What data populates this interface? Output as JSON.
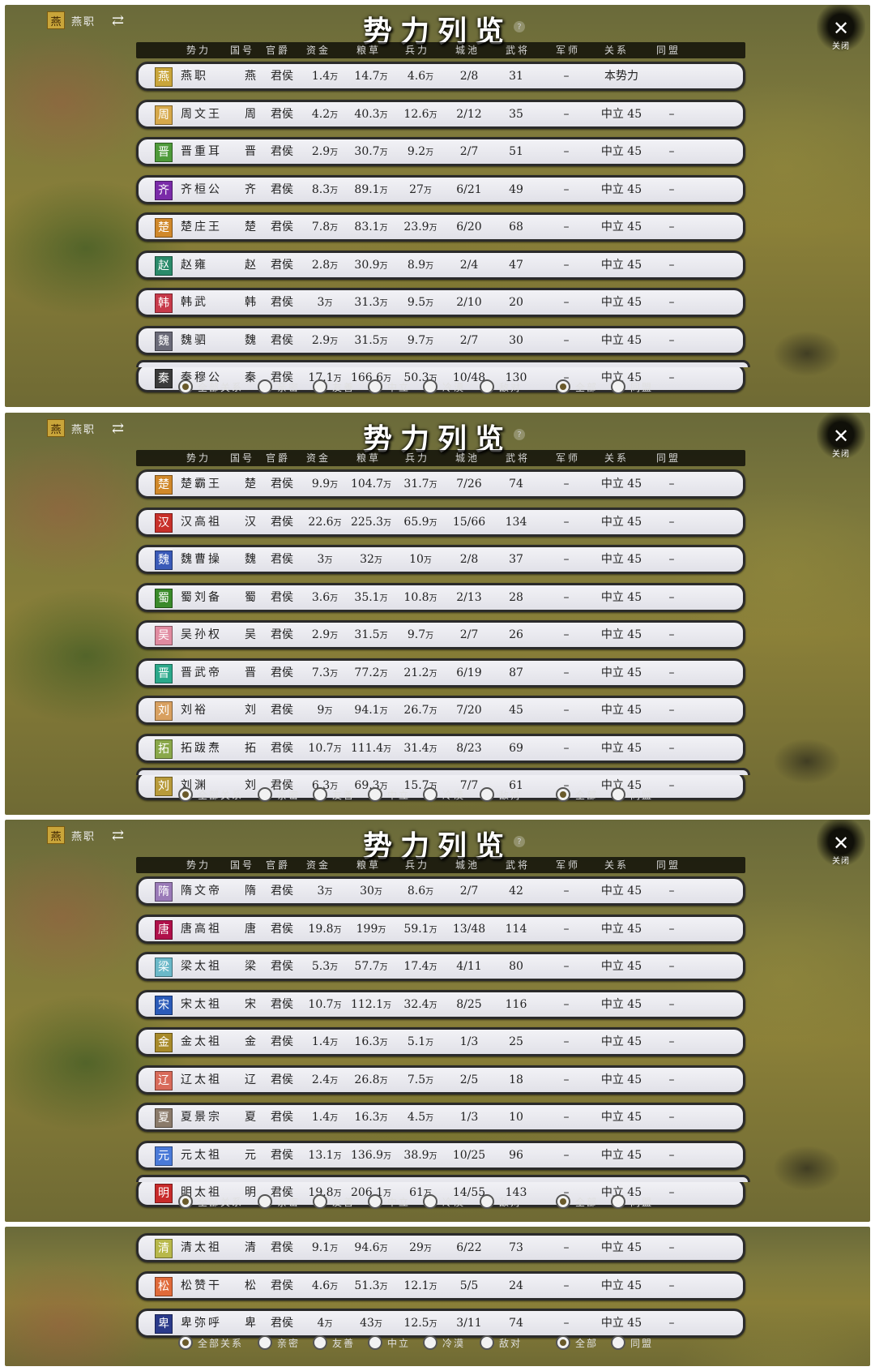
{
  "header": {
    "player_badge": "燕",
    "player_name": "燕职",
    "swap_icon": "⇄",
    "title": "势力列览",
    "help": "?",
    "close_icon": "✕",
    "close_label": "关闭"
  },
  "columns": [
    "势力",
    "国号",
    "官爵",
    "资金",
    "粮草",
    "兵力",
    "城池",
    "武将",
    "军师",
    "关系",
    "同盟"
  ],
  "unit": "万",
  "filters": {
    "relations": [
      "全部关系",
      "亲密",
      "友善",
      "中立",
      "冷漠",
      "敌对"
    ],
    "alliance": [
      "全部",
      "同盟"
    ],
    "selected_relation": "全部关系",
    "selected_alliance": "全部"
  },
  "pages": [
    {
      "rows": [
        {
          "badge": "燕",
          "color": "#c9a53a",
          "name": "燕职",
          "nation": "燕",
          "rank": "君侯",
          "gold": "1.4",
          "food": "14.7",
          "troops": "4.6",
          "cities": "2/8",
          "generals": "31",
          "strategist": "–",
          "relation": "本势力",
          "alliance": ""
        },
        {
          "badge": "周",
          "color": "#d6a84a",
          "name": "周文王",
          "nation": "周",
          "rank": "君侯",
          "gold": "4.2",
          "food": "40.3",
          "troops": "12.6",
          "cities": "2/12",
          "generals": "35",
          "strategist": "–",
          "relation": "中立 45",
          "alliance": "–"
        },
        {
          "badge": "晋",
          "color": "#4e9a3a",
          "name": "晋重耳",
          "nation": "晋",
          "rank": "君侯",
          "gold": "2.9",
          "food": "30.7",
          "troops": "9.2",
          "cities": "2/7",
          "generals": "51",
          "strategist": "–",
          "relation": "中立 45",
          "alliance": "–"
        },
        {
          "badge": "齐",
          "color": "#7a2aa8",
          "name": "齐桓公",
          "nation": "齐",
          "rank": "君侯",
          "gold": "8.3",
          "food": "89.1",
          "troops": "27",
          "cities": "6/21",
          "generals": "49",
          "strategist": "–",
          "relation": "中立 45",
          "alliance": "–"
        },
        {
          "badge": "楚",
          "color": "#d0882a",
          "name": "楚庄王",
          "nation": "楚",
          "rank": "君侯",
          "gold": "7.8",
          "food": "83.1",
          "troops": "23.9",
          "cities": "6/20",
          "generals": "68",
          "strategist": "–",
          "relation": "中立 45",
          "alliance": "–"
        },
        {
          "badge": "赵",
          "color": "#2a8a6a",
          "name": "赵雍",
          "nation": "赵",
          "rank": "君侯",
          "gold": "2.8",
          "food": "30.9",
          "troops": "8.9",
          "cities": "2/4",
          "generals": "47",
          "strategist": "–",
          "relation": "中立 45",
          "alliance": "–"
        },
        {
          "badge": "韩",
          "color": "#c83a4a",
          "name": "韩武",
          "nation": "韩",
          "rank": "君侯",
          "gold": "3",
          "food": "31.3",
          "troops": "9.5",
          "cities": "2/10",
          "generals": "20",
          "strategist": "–",
          "relation": "中立 45",
          "alliance": "–"
        },
        {
          "badge": "魏",
          "color": "#6a6a78",
          "name": "魏驷",
          "nation": "魏",
          "rank": "君侯",
          "gold": "2.9",
          "food": "31.5",
          "troops": "9.7",
          "cities": "2/7",
          "generals": "30",
          "strategist": "–",
          "relation": "中立 45",
          "alliance": "–"
        },
        {
          "badge": "秦",
          "color": "#3a3a3a",
          "name": "秦穆公",
          "nation": "秦",
          "rank": "君侯",
          "gold": "17.1",
          "food": "166.6",
          "troops": "50.3",
          "cities": "10/48",
          "generals": "130",
          "strategist": "–",
          "relation": "中立 45",
          "alliance": "–"
        }
      ]
    },
    {
      "rows": [
        {
          "badge": "楚",
          "color": "#d0882a",
          "name": "楚霸王",
          "nation": "楚",
          "rank": "君侯",
          "gold": "9.9",
          "food": "104.7",
          "troops": "31.7",
          "cities": "7/26",
          "generals": "74",
          "strategist": "–",
          "relation": "中立 45",
          "alliance": "–"
        },
        {
          "badge": "汉",
          "color": "#c8302a",
          "name": "汉高祖",
          "nation": "汉",
          "rank": "君侯",
          "gold": "22.6",
          "food": "225.3",
          "troops": "65.9",
          "cities": "15/66",
          "generals": "134",
          "strategist": "–",
          "relation": "中立 45",
          "alliance": "–"
        },
        {
          "badge": "魏",
          "color": "#3a5ab8",
          "name": "魏曹操",
          "nation": "魏",
          "rank": "君侯",
          "gold": "3",
          "food": "32",
          "troops": "10",
          "cities": "2/8",
          "generals": "37",
          "strategist": "–",
          "relation": "中立 45",
          "alliance": "–"
        },
        {
          "badge": "蜀",
          "color": "#3a8a2a",
          "name": "蜀刘备",
          "nation": "蜀",
          "rank": "君侯",
          "gold": "3.6",
          "food": "35.1",
          "troops": "10.8",
          "cities": "2/13",
          "generals": "28",
          "strategist": "–",
          "relation": "中立 45",
          "alliance": "–"
        },
        {
          "badge": "吴",
          "color": "#e08aa0",
          "name": "吴孙权",
          "nation": "吴",
          "rank": "君侯",
          "gold": "2.9",
          "food": "31.5",
          "troops": "9.7",
          "cities": "2/7",
          "generals": "26",
          "strategist": "–",
          "relation": "中立 45",
          "alliance": "–"
        },
        {
          "badge": "晋",
          "color": "#2aa88a",
          "name": "晋武帝",
          "nation": "晋",
          "rank": "君侯",
          "gold": "7.3",
          "food": "77.2",
          "troops": "21.2",
          "cities": "6/19",
          "generals": "87",
          "strategist": "–",
          "relation": "中立 45",
          "alliance": "–"
        },
        {
          "badge": "刘",
          "color": "#d8a060",
          "name": "刘裕",
          "nation": "刘",
          "rank": "君侯",
          "gold": "9",
          "food": "94.1",
          "troops": "26.7",
          "cities": "7/20",
          "generals": "45",
          "strategist": "–",
          "relation": "中立 45",
          "alliance": "–"
        },
        {
          "badge": "拓",
          "color": "#8aa84a",
          "name": "拓跋焘",
          "nation": "拓",
          "rank": "君侯",
          "gold": "10.7",
          "food": "111.4",
          "troops": "31.4",
          "cities": "8/23",
          "generals": "69",
          "strategist": "–",
          "relation": "中立 45",
          "alliance": "–"
        },
        {
          "badge": "刘",
          "color": "#b89a3a",
          "name": "刘渊",
          "nation": "刘",
          "rank": "君侯",
          "gold": "6.3",
          "food": "69.3",
          "troops": "15.7",
          "cities": "7/7",
          "generals": "61",
          "strategist": "–",
          "relation": "中立 45",
          "alliance": "–"
        }
      ]
    },
    {
      "rows": [
        {
          "badge": "隋",
          "color": "#9a7ab8",
          "name": "隋文帝",
          "nation": "隋",
          "rank": "君侯",
          "gold": "3",
          "food": "30",
          "troops": "8.6",
          "cities": "2/7",
          "generals": "42",
          "strategist": "–",
          "relation": "中立 45",
          "alliance": "–"
        },
        {
          "badge": "唐",
          "color": "#b0104a",
          "name": "唐高祖",
          "nation": "唐",
          "rank": "君侯",
          "gold": "19.8",
          "food": "199",
          "troops": "59.1",
          "cities": "13/48",
          "generals": "114",
          "strategist": "–",
          "relation": "中立 45",
          "alliance": "–"
        },
        {
          "badge": "梁",
          "color": "#6ab8c8",
          "name": "梁太祖",
          "nation": "梁",
          "rank": "君侯",
          "gold": "5.3",
          "food": "57.7",
          "troops": "17.4",
          "cities": "4/11",
          "generals": "80",
          "strategist": "–",
          "relation": "中立 45",
          "alliance": "–"
        },
        {
          "badge": "宋",
          "color": "#2a5ab8",
          "name": "宋太祖",
          "nation": "宋",
          "rank": "君侯",
          "gold": "10.7",
          "food": "112.1",
          "troops": "32.4",
          "cities": "8/25",
          "generals": "116",
          "strategist": "–",
          "relation": "中立 45",
          "alliance": "–"
        },
        {
          "badge": "金",
          "color": "#a88a2a",
          "name": "金太祖",
          "nation": "金",
          "rank": "君侯",
          "gold": "1.4",
          "food": "16.3",
          "troops": "5.1",
          "cities": "1/3",
          "generals": "25",
          "strategist": "–",
          "relation": "中立 45",
          "alliance": "–"
        },
        {
          "badge": "辽",
          "color": "#d86a5a",
          "name": "辽太祖",
          "nation": "辽",
          "rank": "君侯",
          "gold": "2.4",
          "food": "26.8",
          "troops": "7.5",
          "cities": "2/5",
          "generals": "18",
          "strategist": "–",
          "relation": "中立 45",
          "alliance": "–"
        },
        {
          "badge": "夏",
          "color": "#8a7a6a",
          "name": "夏景宗",
          "nation": "夏",
          "rank": "君侯",
          "gold": "1.4",
          "food": "16.3",
          "troops": "4.5",
          "cities": "1/3",
          "generals": "10",
          "strategist": "–",
          "relation": "中立 45",
          "alliance": "–"
        },
        {
          "badge": "元",
          "color": "#4a7ad8",
          "name": "元太祖",
          "nation": "元",
          "rank": "君侯",
          "gold": "13.1",
          "food": "136.9",
          "troops": "38.9",
          "cities": "10/25",
          "generals": "96",
          "strategist": "–",
          "relation": "中立 45",
          "alliance": "–"
        },
        {
          "badge": "明",
          "color": "#c82a2a",
          "name": "明太祖",
          "nation": "明",
          "rank": "君侯",
          "gold": "19.8",
          "food": "206.1",
          "troops": "61",
          "cities": "14/55",
          "generals": "143",
          "strategist": "–",
          "relation": "中立 45",
          "alliance": "–"
        }
      ]
    },
    {
      "rows": [
        {
          "badge": "清",
          "color": "#b8b84a",
          "name": "清太祖",
          "nation": "清",
          "rank": "君侯",
          "gold": "9.1",
          "food": "94.6",
          "troops": "29",
          "cities": "6/22",
          "generals": "73",
          "strategist": "–",
          "relation": "中立 45",
          "alliance": "–"
        },
        {
          "badge": "松",
          "color": "#e06a3a",
          "name": "松赞干",
          "nation": "松",
          "rank": "君侯",
          "gold": "4.6",
          "food": "51.3",
          "troops": "12.1",
          "cities": "5/5",
          "generals": "24",
          "strategist": "–",
          "relation": "中立 45",
          "alliance": "–"
        },
        {
          "badge": "卑",
          "color": "#2a3a8a",
          "name": "卑弥呼",
          "nation": "卑",
          "rank": "君侯",
          "gold": "4",
          "food": "43",
          "troops": "12.5",
          "cities": "3/11",
          "generals": "74",
          "strategist": "–",
          "relation": "中立 45",
          "alliance": "–"
        }
      ]
    }
  ]
}
